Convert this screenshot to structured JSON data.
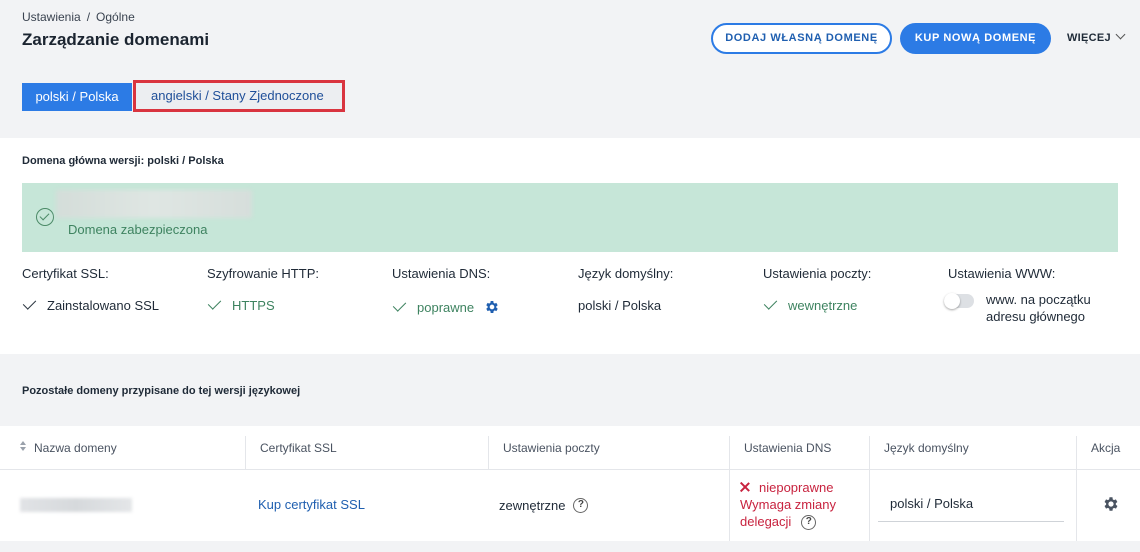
{
  "breadcrumb": {
    "parent": "Ustawienia",
    "separator": "/",
    "current": "Ogólne"
  },
  "page": {
    "title": "Zarządzanie domenami"
  },
  "actions": {
    "add_own_domain": "DODAJ WŁASNĄ DOMENĘ",
    "buy_new_domain": "KUP NOWĄ DOMENĘ",
    "more": "WIĘCEJ"
  },
  "tabs": [
    {
      "label": "polski / Polska",
      "active": true
    },
    {
      "label": "angielski / Stany Zjednoczone",
      "active": false
    }
  ],
  "main_domain": {
    "section_title": "Domena główna wersji: polski / Polska",
    "status": "Domena zabezpieczona",
    "status_color": "#c6e6d8"
  },
  "settings": {
    "ssl": {
      "label": "Certyfikat SSL:",
      "value": "Zainstalowano SSL"
    },
    "http": {
      "label": "Szyfrowanie HTTP:",
      "value": "HTTPS"
    },
    "dns": {
      "label": "Ustawienia DNS:",
      "value": "poprawne"
    },
    "language": {
      "label": "Język domyślny:",
      "value": "polski / Polska"
    },
    "mail": {
      "label": "Ustawienia poczty:",
      "value": "wewnętrzne"
    },
    "www": {
      "label": "Ustawienia WWW:",
      "value": "www. na początku adresu głównego",
      "enabled": false
    }
  },
  "other_domains": {
    "section_title": "Pozostałe domeny przypisane do tej wersji językowej",
    "columns": [
      "Nazwa domeny",
      "Certyfikat SSL",
      "Ustawienia poczty",
      "Ustawienia DNS",
      "Język domyślny",
      "Akcja"
    ],
    "rows": [
      {
        "ssl": "Kup certyfikat SSL",
        "mail": "zewnętrzne",
        "dns_status": "niepoprawne",
        "dns_note": "Wymaga zmiany delegacji",
        "language": "polski / Polska"
      }
    ]
  },
  "colors": {
    "accent": "#2c7be5",
    "success": "#3e8360",
    "error": "#c8233f",
    "highlight_border": "#d9343f"
  }
}
